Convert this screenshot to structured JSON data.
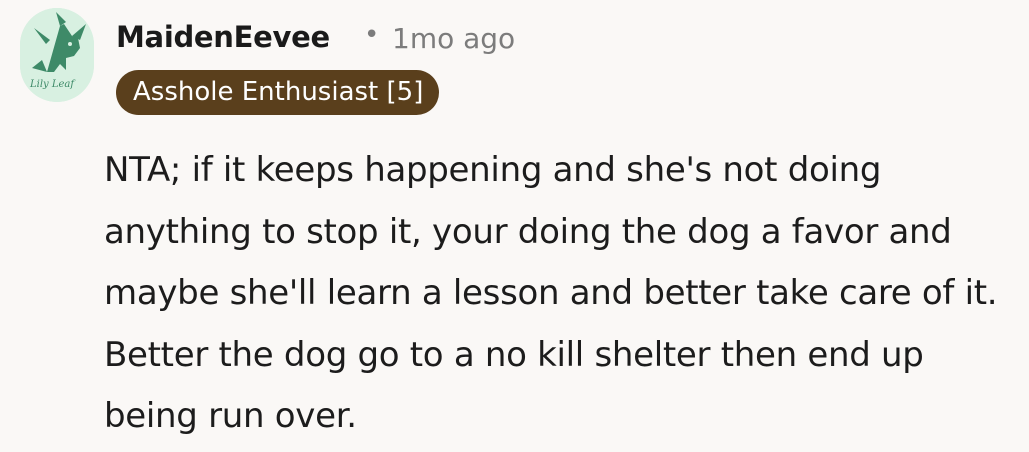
{
  "comment": {
    "author": "MaidenEevee",
    "separator": "•",
    "timestamp": "1mo ago",
    "flair": "Asshole Enthusiast [5]",
    "avatar_caption": "Lily Leaf",
    "body": "NTA; if it keeps happening and she's not doing anything to stop it, your doing the dog a favor and maybe she'll learn a lesson and better take care of it. Better the dog go to a no kill shelter then end up being run over."
  },
  "colors": {
    "background": "#faf8f6",
    "flair_background": "#5a3f1c",
    "flair_text": "#ffffff",
    "meta_text": "#7c7c7c",
    "avatar_background": "#d8f0e1",
    "avatar_figure": "#3e8a68"
  }
}
